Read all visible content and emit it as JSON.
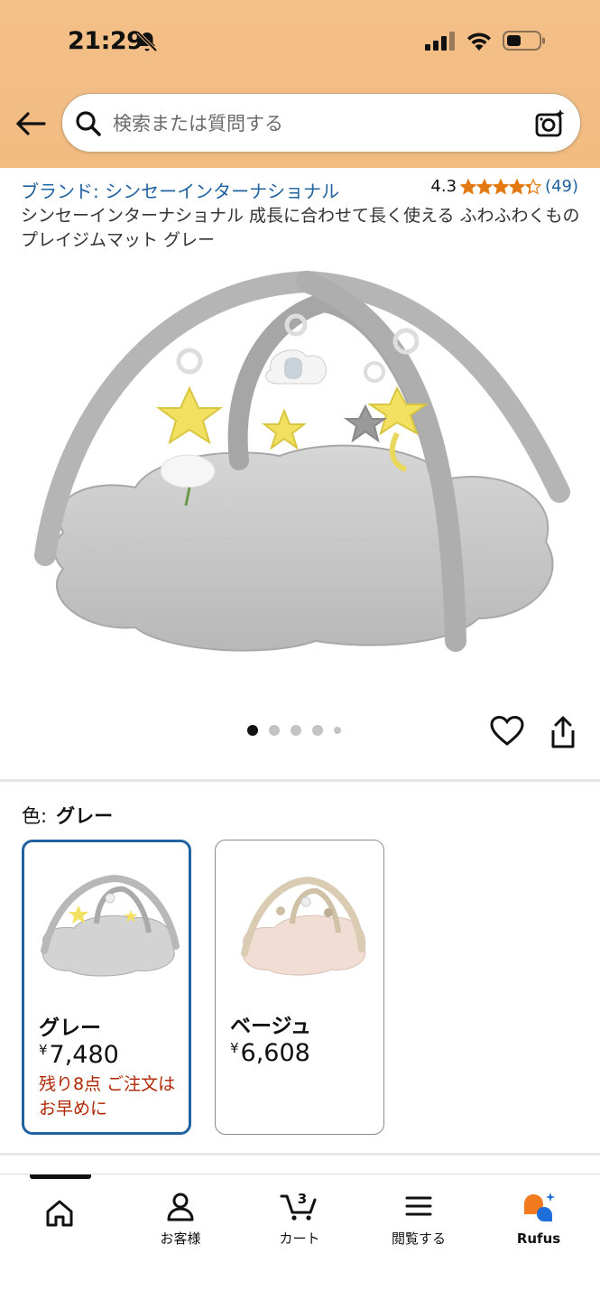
{
  "status_bar": {
    "time": "21:29"
  },
  "search": {
    "placeholder": "検索または質問する"
  },
  "product": {
    "brand_link": "ブランド: シンセーインターナショナル",
    "rating_value": "4.3",
    "rating_stars": 4.3,
    "review_count": "(49)",
    "title": "シンセーインターナショナル 成長に合わせて長く使える ふわふわくものプレイジムマット グレー",
    "image_count": 5,
    "active_image_index": 0
  },
  "color_selector": {
    "label": "色:",
    "selected_value": "グレー",
    "variants": [
      {
        "name": "グレー",
        "currency": "¥",
        "price": "7,480",
        "stock_note": "残り8点 ご注文はお早めに",
        "selected": true
      },
      {
        "name": "ベージュ",
        "currency": "¥",
        "price": "6,608",
        "stock_note": "",
        "selected": false
      }
    ]
  },
  "bottom_nav": {
    "items": [
      {
        "label": "",
        "icon": "home-icon"
      },
      {
        "label": "お客様",
        "icon": "account-icon"
      },
      {
        "label": "カート",
        "icon": "cart-icon",
        "badge": "3"
      },
      {
        "label": "閲覧する",
        "icon": "menu-icon"
      },
      {
        "label": "Rufus",
        "icon": "rufus-icon"
      }
    ]
  },
  "colors": {
    "header_bg": "#f2bb80",
    "link": "#2162a1",
    "star": "#e47911",
    "stock_warning": "#b12704",
    "selected_border": "#2162a1"
  }
}
